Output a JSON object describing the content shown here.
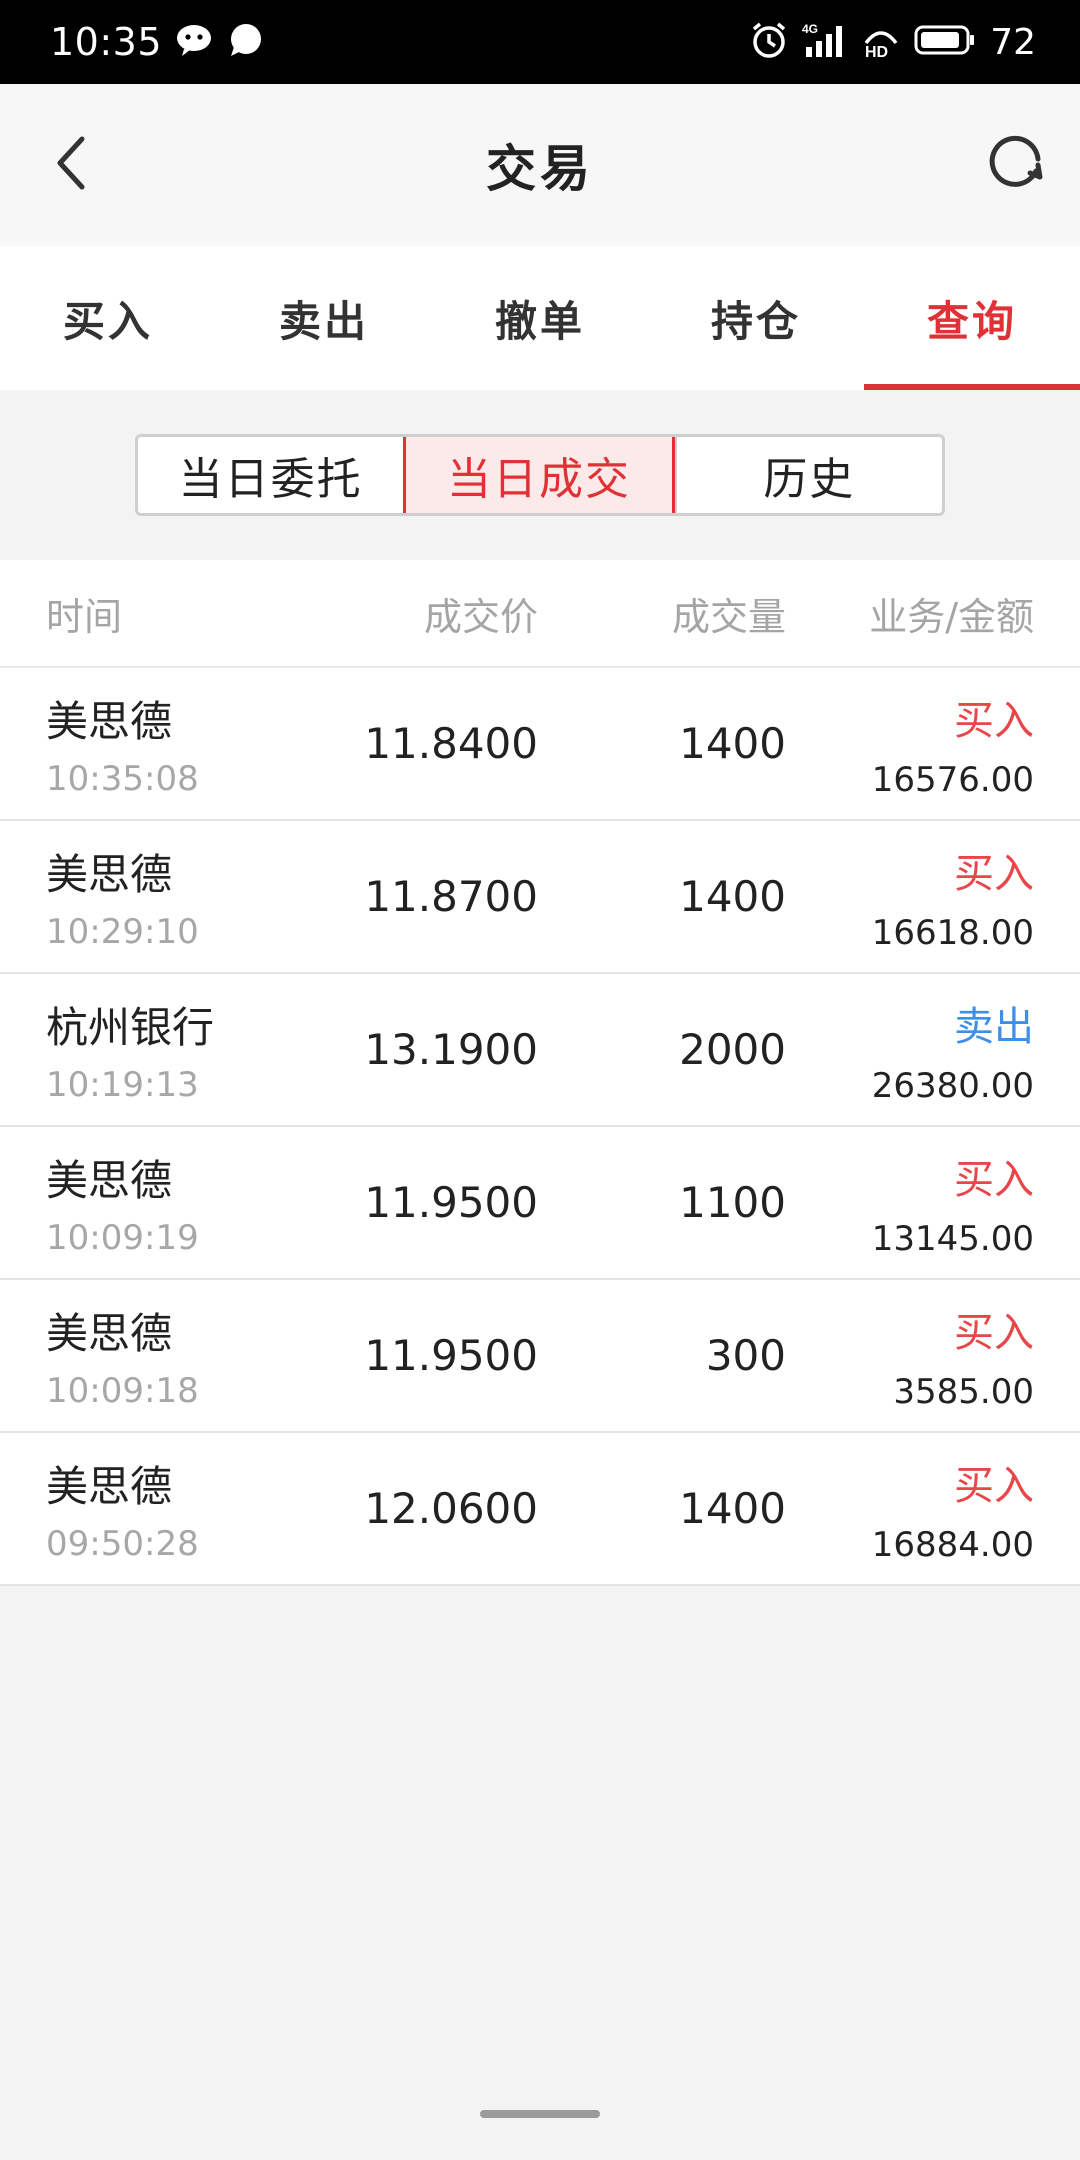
{
  "status_bar": {
    "time": "10:35",
    "battery": "72",
    "icons": [
      "wechat-icon",
      "chat-bubble-icon",
      "alarm-icon",
      "signal-4g-icon",
      "hd-icon",
      "battery-icon"
    ]
  },
  "header": {
    "title": "交易",
    "back_icon": "chevron-left-icon",
    "refresh_icon": "refresh-icon"
  },
  "tabs": [
    {
      "label": "买入"
    },
    {
      "label": "卖出"
    },
    {
      "label": "撤单"
    },
    {
      "label": "持仓"
    },
    {
      "label": "查询",
      "active": true
    }
  ],
  "segments": [
    {
      "label": "当日委托"
    },
    {
      "label": "当日成交",
      "active": true
    },
    {
      "label": "历史"
    }
  ],
  "table": {
    "columns": [
      "时间",
      "成交价",
      "成交量",
      "业务/金额"
    ],
    "rows": [
      {
        "name": "美思德",
        "time": "10:35:08",
        "price": "11.8400",
        "volume": "1400",
        "biz": "买入",
        "amount": "16576.00"
      },
      {
        "name": "美思德",
        "time": "10:29:10",
        "price": "11.8700",
        "volume": "1400",
        "biz": "买入",
        "amount": "16618.00"
      },
      {
        "name": "杭州银行",
        "time": "10:19:13",
        "price": "13.1900",
        "volume": "2000",
        "biz": "卖出",
        "amount": "26380.00"
      },
      {
        "name": "美思德",
        "time": "10:09:19",
        "price": "11.9500",
        "volume": "1100",
        "biz": "买入",
        "amount": "13145.00"
      },
      {
        "name": "美思德",
        "time": "10:09:18",
        "price": "11.9500",
        "volume": "300",
        "biz": "买入",
        "amount": "3585.00"
      },
      {
        "name": "美思德",
        "time": "09:50:28",
        "price": "12.0600",
        "volume": "1400",
        "biz": "买入",
        "amount": "16884.00"
      }
    ]
  },
  "colors": {
    "accent": "#e03236",
    "buy": "#e8474a",
    "sell": "#3e8fea"
  }
}
